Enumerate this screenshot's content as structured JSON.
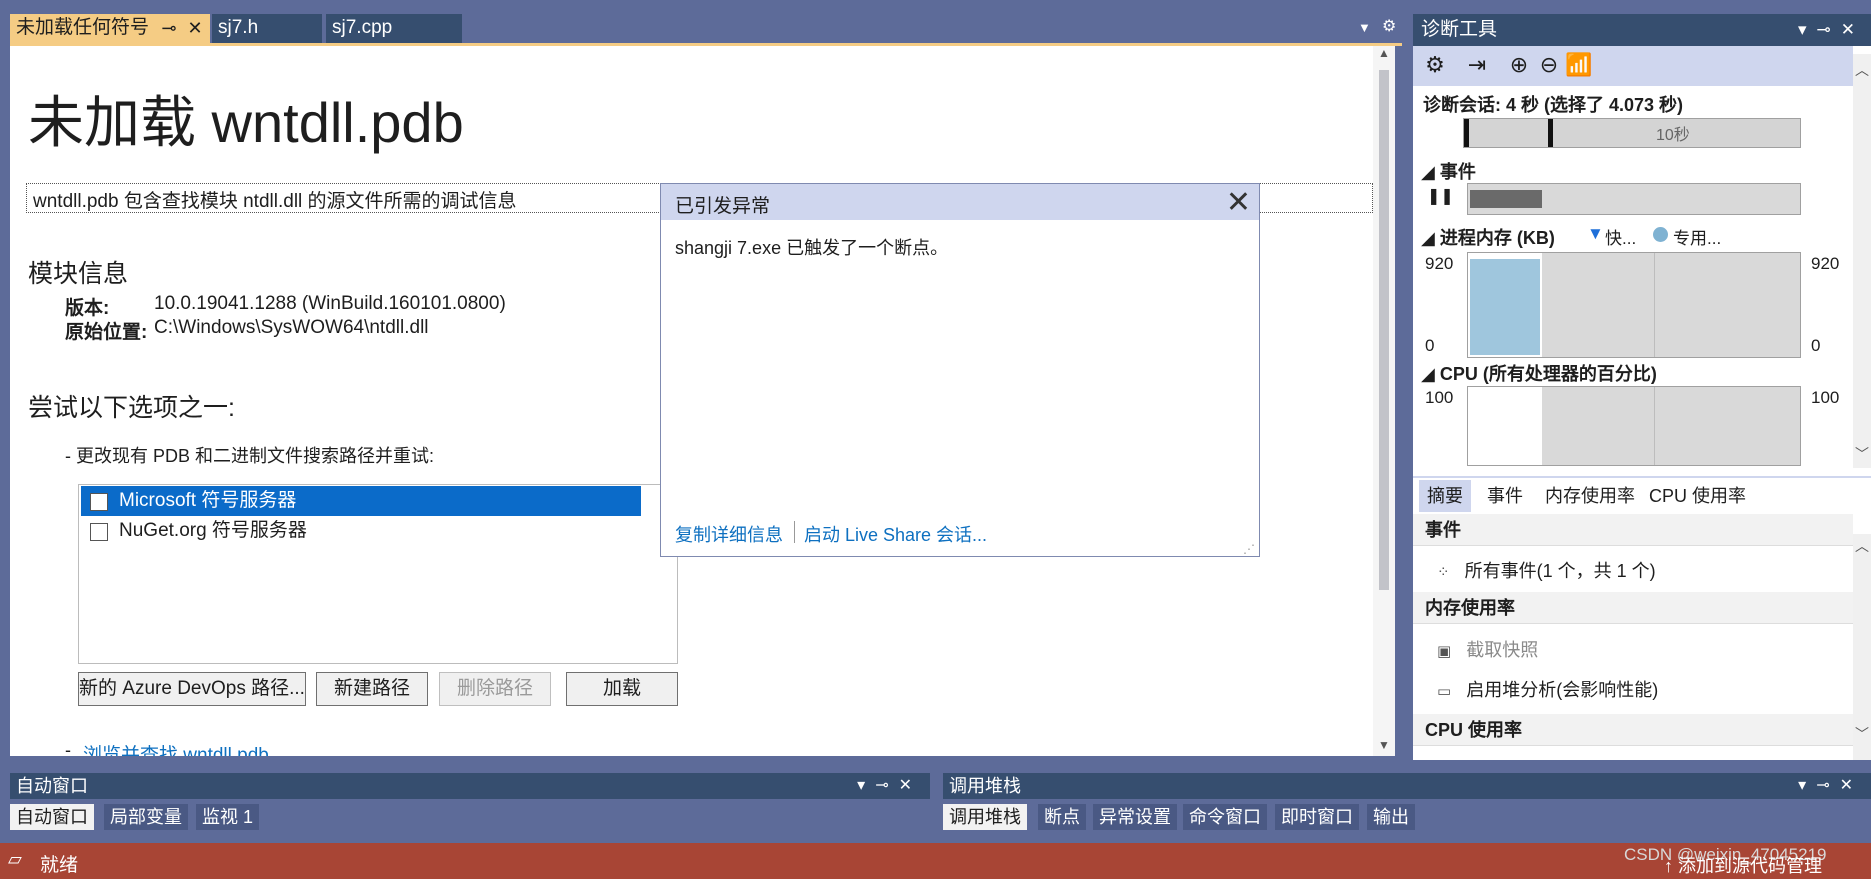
{
  "doc_tabs": [
    {
      "label": "未加载任何符号",
      "active": true
    },
    {
      "label": "sj7.h",
      "active": false
    },
    {
      "label": "sj7.cpp",
      "active": false
    }
  ],
  "doc": {
    "title": "未加载 wntdll.pdb",
    "description": "wntdll.pdb 包含查找模块 ntdll.dll 的源文件所需的调试信息",
    "module_info_heading": "模块信息",
    "version_label": "版本:",
    "version_value": "10.0.19041.1288 (WinBuild.160101.0800)",
    "location_label": "原始位置:",
    "location_value": "C:\\Windows\\SysWOW64\\ntdll.dll",
    "try_heading": "尝试以下选项之一:",
    "option1": "-  更改现有 PDB 和二进制文件搜索路径并重试:",
    "servers": [
      {
        "label": "Microsoft 符号服务器",
        "selected": true,
        "checked": false
      },
      {
        "label": "NuGet.org 符号服务器",
        "selected": false,
        "checked": false
      }
    ],
    "buttons": {
      "azure": "新的 Azure DevOps 路径...",
      "new_path": "新建路径",
      "delete_path": "删除路径",
      "load": "加载"
    },
    "option2_prefix": "-",
    "option2_link": "浏览并查找 wntdll.pdb..."
  },
  "popup": {
    "title": "已引发异常",
    "message": "shangji 7.exe 已触发了一个断点。",
    "copy_link": "复制详细信息",
    "liveshare_link": "启动 Live Share 会话..."
  },
  "diag": {
    "title": "诊断工具",
    "session": "诊断会话: 4 秒 (选择了 4.073 秒)",
    "timeline_tick": "10秒",
    "events_label": "事件",
    "mem_label": "进程内存 (KB)",
    "mem_legend_fast": "快...",
    "mem_legend_private": "专用...",
    "mem_max": "920",
    "mem_min": "0",
    "mem_used_fraction": 0.96,
    "cpu_label": "CPU (所有处理器的百分比)",
    "cpu_max": "100",
    "tabs": [
      "摘要",
      "事件",
      "内存使用率",
      "CPU 使用率"
    ],
    "events_group": "事件",
    "all_events": "所有事件(1 个，共 1 个)",
    "memory_group": "内存使用率",
    "snapshot": "截取快照",
    "heap": "启用堆分析(会影响性能)",
    "cpu_group": "CPU 使用率"
  },
  "auto_panel": {
    "title": "自动窗口",
    "tabs": [
      "自动窗口",
      "局部变量",
      "监视 1"
    ]
  },
  "callstack_panel": {
    "title": "调用堆栈",
    "tabs": [
      "调用堆栈",
      "断点",
      "异常设置",
      "命令窗口",
      "即时窗口",
      "输出"
    ]
  },
  "status": {
    "text": "就绪",
    "right_text": "添加到源代码管理",
    "watermark": "CSDN @weixin_47045219"
  },
  "colors": {
    "accent_tab": "#f5cc84",
    "chrome": "#5d6b99",
    "panel_header": "#364e6f",
    "status_bar": "#a84535",
    "selection": "#0b6bc9",
    "link": "#0e70c0",
    "memory_fill": "#9fc6dd"
  }
}
